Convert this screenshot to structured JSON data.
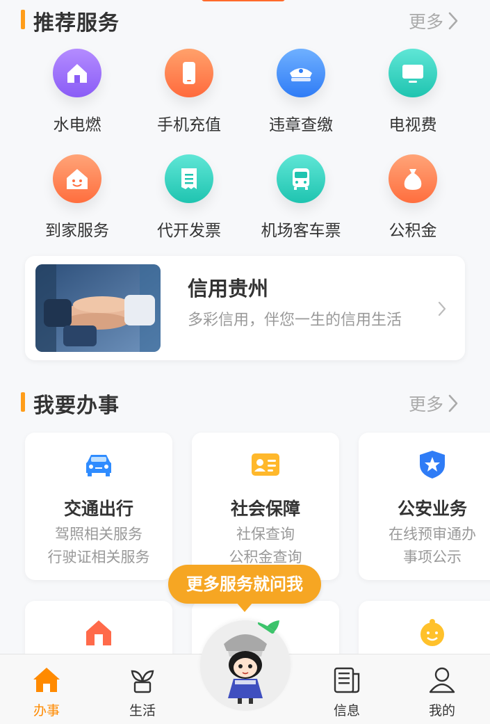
{
  "colors": {
    "accent": "#ff9d1a",
    "bubble": "#f6a623",
    "tab_active": "#ff8a00"
  },
  "recommended": {
    "title": "推荐服务",
    "more": "更多",
    "items": [
      {
        "label": "水电燃",
        "icon": "house-icon",
        "color": "#9b6cff"
      },
      {
        "label": "手机充值",
        "icon": "phone-icon",
        "color": "#ff7a45"
      },
      {
        "label": "违章查缴",
        "icon": "police-cap-icon",
        "color": "#3d8bff"
      },
      {
        "label": "电视费",
        "icon": "tv-icon",
        "color": "#2fd3c0"
      },
      {
        "label": "到家服务",
        "icon": "smile-house-icon",
        "color": "#ff8a55"
      },
      {
        "label": "代开发票",
        "icon": "invoice-icon",
        "color": "#2fd3c0"
      },
      {
        "label": "机场客车票",
        "icon": "bus-icon",
        "color": "#2fd3c0"
      },
      {
        "label": "公积金",
        "icon": "money-bag-icon",
        "color": "#ff8a55"
      }
    ]
  },
  "banner": {
    "title": "信用贵州",
    "subtitle": "多彩信用，伴您一生的信用生活"
  },
  "tasks": {
    "title": "我要办事",
    "more": "更多",
    "cards": [
      {
        "title": "交通出行",
        "lines": [
          "驾照相关服务",
          "行驶证相关服务"
        ],
        "icon": "car-icon"
      },
      {
        "title": "社会保障",
        "lines": [
          "社保查询",
          "公积金查询"
        ],
        "icon": "id-card-icon"
      },
      {
        "title": "公安业务",
        "lines": [
          "在线预审通办",
          "事项公示"
        ],
        "icon": "police-shield-icon"
      }
    ],
    "partial_cards": [
      {
        "icon": "house-icon"
      },
      {
        "icon": "leaf-icon"
      },
      {
        "icon": "baby-icon"
      }
    ]
  },
  "assistant": {
    "bubble_text": "更多服务就问我"
  },
  "tabbar": {
    "items": [
      {
        "label": "办事",
        "icon": "home-icon",
        "active": true
      },
      {
        "label": "生活",
        "icon": "plant-icon",
        "active": false
      },
      {
        "label": "信息",
        "icon": "news-icon",
        "active": false
      },
      {
        "label": "我的",
        "icon": "user-icon",
        "active": false
      }
    ]
  }
}
